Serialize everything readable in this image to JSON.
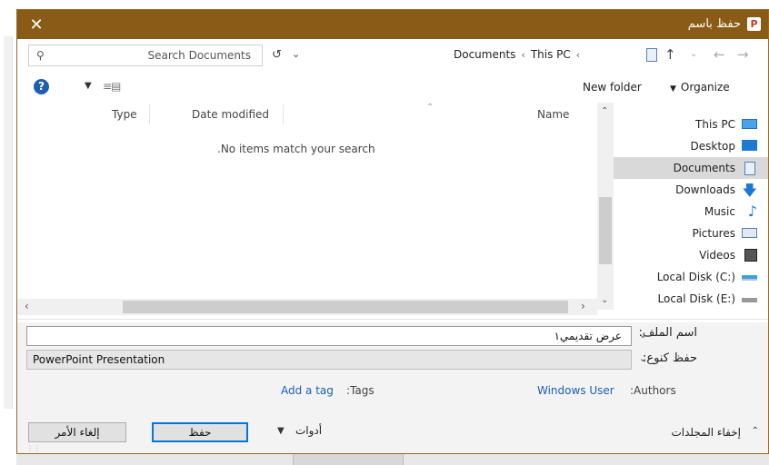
{
  "window": {
    "title": "حفظ باسم",
    "app_icon": "P",
    "close": "✕"
  },
  "address": {
    "search_placeholder": "Search Documents",
    "breadcrumb": [
      "Documents",
      "This PC"
    ],
    "sep": "‹"
  },
  "toolbar": {
    "new_folder": "New folder",
    "organize": "Organize"
  },
  "file_list": {
    "columns": {
      "type": "Type",
      "date": "Date modified",
      "name": "Name"
    },
    "empty_message": ".No items match your search"
  },
  "nav": {
    "items": [
      {
        "label": "This PC",
        "icon": "computer-icon"
      },
      {
        "label": "Desktop",
        "icon": "desktop-icon"
      },
      {
        "label": "Documents",
        "icon": "documents-icon",
        "selected": true
      },
      {
        "label": "Downloads",
        "icon": "downloads-icon"
      },
      {
        "label": "Music",
        "icon": "music-icon"
      },
      {
        "label": "Pictures",
        "icon": "pictures-icon"
      },
      {
        "label": "Videos",
        "icon": "videos-icon"
      },
      {
        "label": "Local Disk (C:)",
        "icon": "drive-c-icon"
      },
      {
        "label": "Local Disk (E:)",
        "icon": "drive-e-icon"
      }
    ]
  },
  "form": {
    "filename_label": "اسم الملف:",
    "filename_value": "عرض تقديمي١",
    "savetype_label": "حفظ كنوع:",
    "savetype_value": "PowerPoint Presentation"
  },
  "meta": {
    "add_tag": "Add a tag",
    "tags_label": ":Tags",
    "author": "Windows User",
    "authors_label": ":Authors"
  },
  "buttons": {
    "cancel": "إلغاء الأمر",
    "save": "حفظ",
    "tools": "أدوات",
    "hide_folders": "إخفاء المجلدات"
  },
  "colors": {
    "titlebar": "#8a5b16",
    "accent": "#0078d7",
    "link": "#1a5fb4"
  }
}
